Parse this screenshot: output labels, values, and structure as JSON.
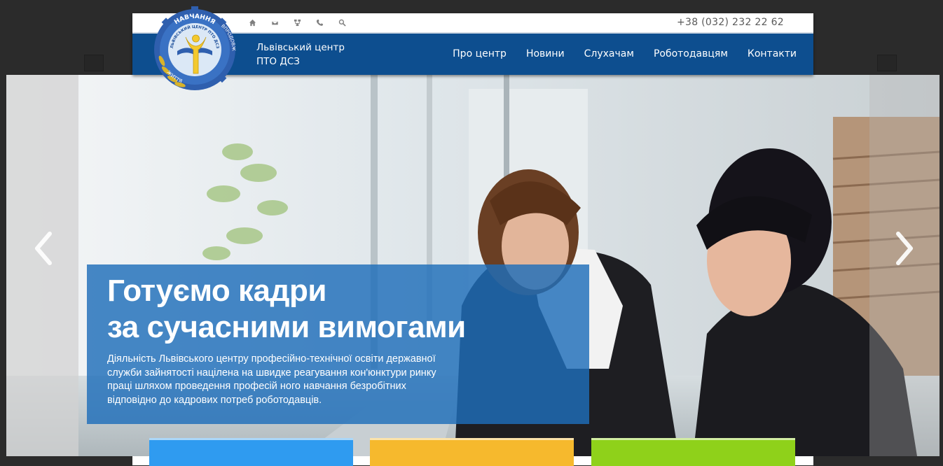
{
  "header": {
    "phone": "+38 (032) 232 22 62",
    "brand_line1": "Львівський центр",
    "brand_line2": "ПТО ДСЗ",
    "toolbar_icons": [
      "home-icon",
      "mail-icon",
      "sitemap-icon",
      "phone-icon",
      "search-icon"
    ],
    "logo_text_top": "НАВЧАННЯ",
    "logo_text_ring": "ЛЬВІВСЬКИЙ ЦЕНТР ПТО ДСЗ",
    "logo_text_right": "ВПРОДОВЖ",
    "logo_text_left": "ЖИТТЯ"
  },
  "nav": {
    "items": [
      {
        "label": "Про центр"
      },
      {
        "label": "Новини"
      },
      {
        "label": "Слухачам"
      },
      {
        "label": "Роботодавцям"
      },
      {
        "label": "Контакти"
      }
    ]
  },
  "slider": {
    "title_line1": "Готуємо кадри",
    "title_line2": "за сучасними вимогами",
    "description": "Діяльність Львівського центру професійно-технічної освіти державної служби зайнятості націлена на швидке реагування кон'юнктури ринку праці шляхом проведення професій ного навчання безробітних відповідно до кадрових потреб роботодавців.",
    "prev_icon": "chevron-left-icon",
    "next_icon": "chevron-right-icon"
  },
  "tiles": [
    {
      "name": "tile-blue",
      "color": "#2f9bf0"
    },
    {
      "name": "tile-yellow",
      "color": "#f6b92d"
    },
    {
      "name": "tile-green",
      "color": "#8fd11a"
    }
  ],
  "colors": {
    "nav_bg": "#0d4e8f",
    "caption_bg": "#1e6eb9",
    "page_bg": "#2b2b2b"
  }
}
